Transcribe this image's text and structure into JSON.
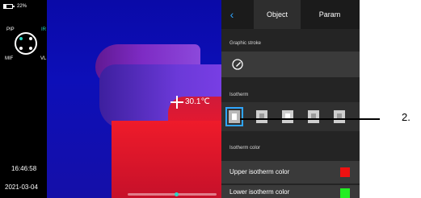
{
  "status": {
    "battery_percent": "22%"
  },
  "modes": {
    "pip": "PIP",
    "ir": "IR",
    "mif": "MIF",
    "vl": "VL"
  },
  "clock": {
    "time": "16:46:58",
    "date": "2021-03-04"
  },
  "thermal": {
    "spot_temperature": "30.1℃"
  },
  "tabs": {
    "object": "Object",
    "param": "Param"
  },
  "sections": {
    "graphic_stroke": "Graphic stroke",
    "isotherm": "Isotherm",
    "isotherm_color": "Isotherm color"
  },
  "rows": {
    "upper_isotherm_color": "Upper isotherm color",
    "lower_isotherm_color": "Lower isotherm color"
  },
  "colors": {
    "accent": "#2fa6ff",
    "ir_indicator": "#28d7c5",
    "upper_isotherm": "#ee1111",
    "lower_isotherm": "#22ee22"
  },
  "icons": {
    "back": "chevron-left-icon",
    "graphic_stroke": "pen-icon"
  },
  "isotherm_options": {
    "count": 5,
    "selected_index": 0
  },
  "callout": {
    "label": "2."
  }
}
